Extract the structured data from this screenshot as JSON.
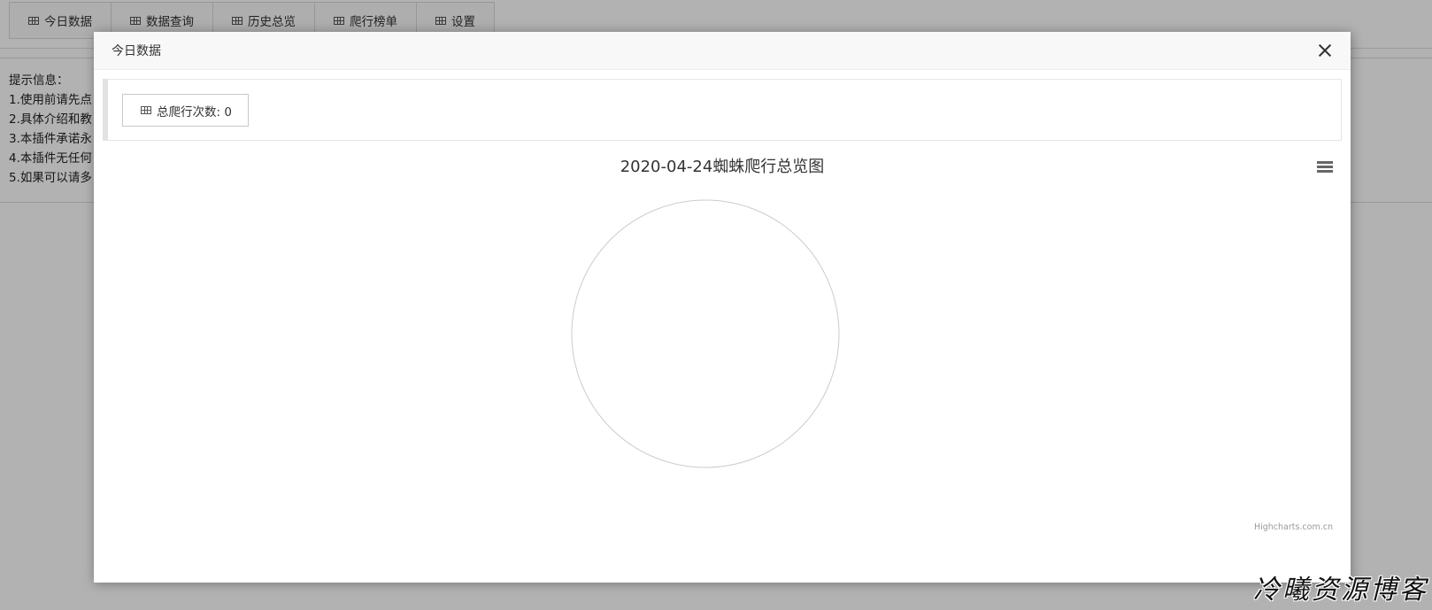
{
  "tabs": [
    {
      "label": "今日数据",
      "icon": "table-icon"
    },
    {
      "label": "数据查询",
      "icon": "table-icon"
    },
    {
      "label": "历史总览",
      "icon": "table-icon"
    },
    {
      "label": "爬行榜单",
      "icon": "table-icon"
    },
    {
      "label": "设置",
      "icon": "table-icon"
    }
  ],
  "tips": {
    "heading": "提示信息：",
    "lines": [
      "1.使用前请先点",
      "2.具体介绍和教",
      "3.本插件承诺永",
      "4.本插件无任何",
      "5.如果可以请多"
    ]
  },
  "modal": {
    "title": "今日数据",
    "stats_label": "总爬行次数: 0"
  },
  "chart_data": {
    "type": "pie",
    "title": "2020-04-24蜘蛛爬行总览图",
    "series": [],
    "empty": true
  },
  "chart_ui": {
    "credits": "Highcharts.com.cn"
  },
  "watermark": "冷曦资源博客",
  "colors": {
    "overlay": "rgba(0,0,0,0.30)",
    "pie_border": "#cccccc"
  }
}
